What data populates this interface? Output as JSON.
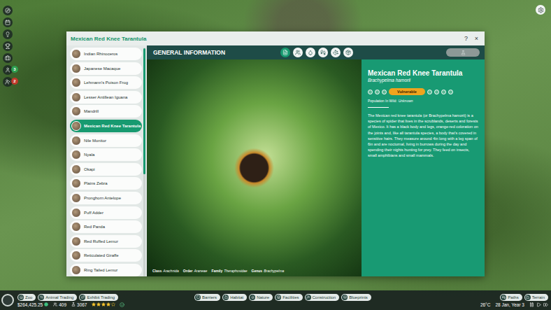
{
  "side_bar": {
    "badges": [
      {
        "count": "3",
        "color": "#2e9e4f"
      },
      {
        "count": "2",
        "color": "#c0392b"
      }
    ]
  },
  "window": {
    "title": "Mexican Red Knee Tarantula",
    "help": "?",
    "close": "×"
  },
  "animals": [
    {
      "name": "Indian Rhinoceros",
      "selected": false
    },
    {
      "name": "Japanese Macaque",
      "selected": false
    },
    {
      "name": "Lehmann's Poison Frog",
      "selected": false
    },
    {
      "name": "Lesser Antillean Iguana",
      "selected": false
    },
    {
      "name": "Mandrill",
      "selected": false
    },
    {
      "name": "Mexican Red Knee Tarantula",
      "selected": true
    },
    {
      "name": "Nile Monitor",
      "selected": false
    },
    {
      "name": "Nyala",
      "selected": false
    },
    {
      "name": "Okapi",
      "selected": false
    },
    {
      "name": "Plains Zebra",
      "selected": false
    },
    {
      "name": "Pronghorn Antelope",
      "selected": false
    },
    {
      "name": "Puff Adder",
      "selected": false
    },
    {
      "name": "Red Panda",
      "selected": false
    },
    {
      "name": "Red Ruffed Lemur",
      "selected": false
    },
    {
      "name": "Reticulated Giraffe",
      "selected": false
    },
    {
      "name": "Ring Tailed Lemur",
      "selected": false
    }
  ],
  "panel": {
    "heading": "GENERAL INFORMATION",
    "tabs": [
      {
        "selected": true
      },
      {
        "selected": false
      },
      {
        "selected": false
      },
      {
        "selected": false
      },
      {
        "selected": false
      },
      {
        "selected": false
      }
    ],
    "action_button": {
      "disabled": true
    }
  },
  "taxonomy": [
    {
      "label": "Class",
      "value": "Arachnida"
    },
    {
      "label": "Order",
      "value": "Araneae"
    },
    {
      "label": "Family",
      "value": "Theraphosidae"
    },
    {
      "label": "Genus",
      "value": "Brachypelma"
    }
  ],
  "info": {
    "name": "Mexican Red Knee Tarantula",
    "scientific_name": "Brachypelma hamorii",
    "status": {
      "label": "Vulnerable",
      "steps": [
        {
          "selected": false
        },
        {
          "selected": false
        },
        {
          "selected": false
        },
        {
          "selected": true
        },
        {
          "selected": false
        },
        {
          "selected": false
        },
        {
          "selected": false
        },
        {
          "selected": false
        }
      ]
    },
    "population": {
      "label": "Population In Wild:",
      "value": "Unknown"
    },
    "description": "The Mexican red knee tarantula (or Brachypelma hamorii) is a species of spider that lives in the scrublands, deserts and forests of Mexico. It has a black body and legs, orange-red coloration on the joints and, like all tarantula species, a body that's covered in sensitive hairs. They measure around 4in long with a leg span of 6in and are nocturnal, living in burrows during the day and spending their nights hunting for prey. They feed on insects, small amphibians and small mammals."
  },
  "toolbar": {
    "left": [
      {
        "label": "Zoo",
        "selected": false
      },
      {
        "label": "Animal Trading",
        "selected": false
      },
      {
        "label": "Exhibit Trading",
        "selected": false
      }
    ],
    "center": [
      {
        "label": "Barriers",
        "selected": false
      },
      {
        "label": "Habitat",
        "selected": false
      },
      {
        "label": "Nature",
        "selected": false
      },
      {
        "label": "Facilities",
        "selected": false
      },
      {
        "label": "Construction",
        "selected": false
      },
      {
        "label": "Blueprints",
        "selected": false
      }
    ],
    "right": [
      {
        "label": "Paths",
        "selected": false
      },
      {
        "label": "Terrain",
        "selected": false
      }
    ]
  },
  "status_bar": {
    "money": "$264,425.25",
    "guests": "409",
    "research": "3067",
    "rating": {
      "stars": 4,
      "max": 5
    },
    "temperature": "26°C",
    "date": "28 Jan, Year 3"
  }
}
